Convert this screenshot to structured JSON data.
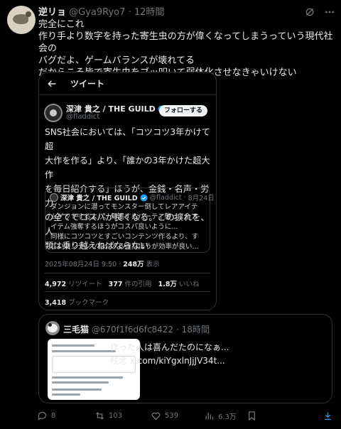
{
  "post": {
    "name": "逆リョ",
    "handle": "@Gya9Ryo7",
    "dot": "·",
    "time": "12時間",
    "lines": [
      "完全にこれ",
      "作り手より数字を持った寄生虫の方が偉くなってしまうっていう現代社会の",
      "バグだよ、ゲームバランスが壊れてる",
      "だからこそ皆で寄生虫をブッ叩いて弱体化させなきゃいけない"
    ]
  },
  "embed": {
    "header_title": "ツイート",
    "author_name": "深津 貴之 / THE GUILD",
    "author_handle": "@fladdict",
    "follow_label": "フォローする",
    "text_lines": [
      "SNS社会においては、「コツコツ3年かけて超",
      "大作を作る」より、「誰かの3年かけた超大作",
      "を毎日紹介する」ほうが、金銭・名声・労力",
      "の全てでコスパが良くなる。この捩れを、人",
      "類は乗り越えねばならない"
    ],
    "quoted": {
      "name": "深津 貴之 / THE GUILD",
      "handle": "@fladdict",
      "date": "8月24日",
      "lines": [
        "ダンジョンに潜ってモンスター倒してレアアイテ",
        "ムゲットするより、帰還するパーティ襲って全ア",
        "イテム強奪するほうがコスパ良いように...",
        "同様にコツコツとすごいコンテンツ作るより、す",
        "ごいコンテンツ紹介する連打ほうが効率が良い..."
      ]
    },
    "datetime": "2025年08月24日 9:50 · ",
    "views_count": "248万",
    "views_label": " 表示",
    "retweets_count": "4,972",
    "retweets_label": " リツイート",
    "quotes_count": "377",
    "quotes_label": " 件の引用",
    "likes_count": "1.8万",
    "likes_label": " いいね",
    "bookmarks_count": "3,418",
    "bookmarks_label": " ブックマーク"
  },
  "quote_post": {
    "name": "三毛猫",
    "handle": "@670f1f6d6fc8422",
    "dot": "·",
    "time": "18時間",
    "line1": "作った人は喜んだたのになぁ...",
    "line2": "残念 x.com/kiYgxlnJjJV34t..."
  },
  "actions": {
    "replies": "8",
    "reposts": "103",
    "likes": "539",
    "views": "6.3万"
  },
  "icons": [
    "grok-icon",
    "more-icon",
    "back-arrow-icon",
    "verified-icon",
    "reply-icon",
    "repost-icon",
    "like-icon",
    "views-icon",
    "bookmark-icon",
    "download-icon"
  ],
  "colors": {
    "background": "#000000",
    "text": "#e7e9ea",
    "muted": "#71767b",
    "border": "#2f3336",
    "verified": "#1d9bf0"
  }
}
